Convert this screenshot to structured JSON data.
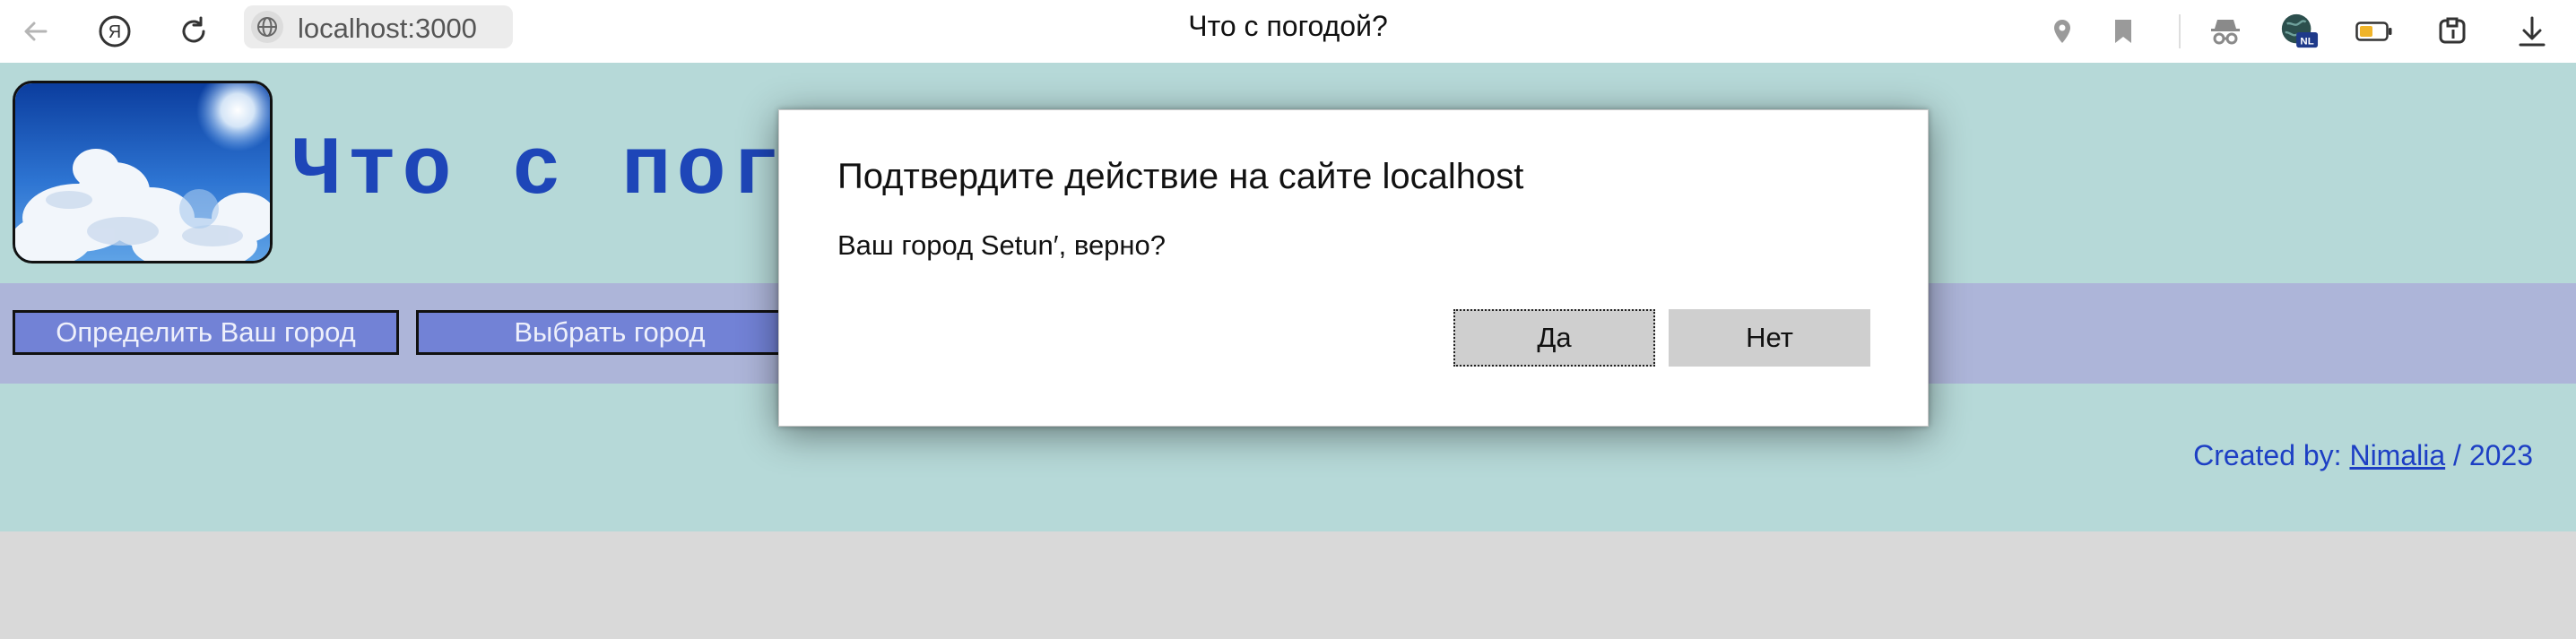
{
  "browser": {
    "url": "localhost:3000",
    "tab_title": "Что с погодой?",
    "icons": [
      "back-icon",
      "yandex-icon",
      "reload-icon",
      "globe-icon",
      "location-pin-icon",
      "bookmark-icon",
      "incognito-icon",
      "vpn-nl-icon",
      "battery-icon",
      "extensions-icon",
      "download-icon"
    ],
    "vpn_badge": "NL"
  },
  "site": {
    "title": "Что с пог",
    "nav": {
      "detect_city_label": "Определить Ваш город",
      "choose_city_label": "Выбрать город"
    },
    "footer": {
      "prefix": "Created by: ",
      "author": "Nimalia",
      "suffix": " / 2023"
    }
  },
  "dialog": {
    "title": "Подтвердите действие на сайте localhost",
    "message": "Ваш город Setun′, верно?",
    "yes_label": "Да",
    "no_label": "Нет"
  },
  "colors": {
    "page_bg": "#b6d9d8",
    "nav_bg": "#adb5d9",
    "nav_button": "#7282d6",
    "title_blue": "#1e46b8",
    "link_blue": "#1d3fc4"
  }
}
